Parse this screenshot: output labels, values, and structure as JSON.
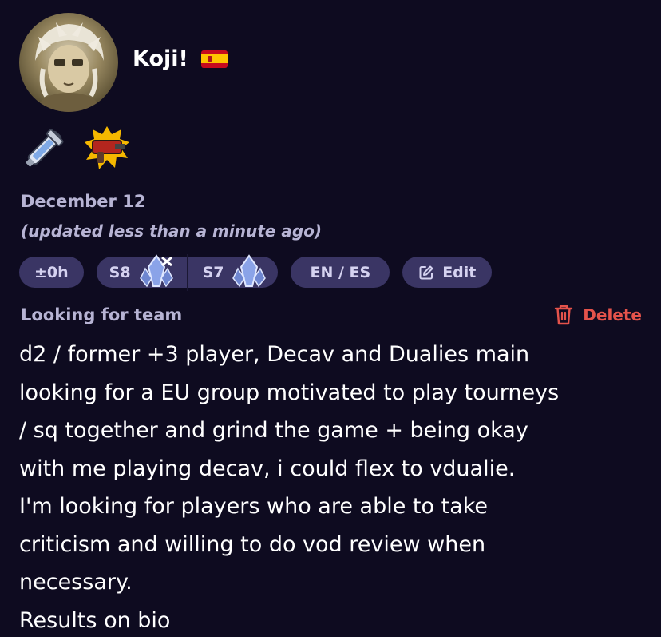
{
  "profile": {
    "username": "Koji!",
    "flag_icon": "spain-flag-icon",
    "avatar_icon": "avatar-portrait"
  },
  "badges": [
    {
      "icon": "weapon-badge-icon"
    },
    {
      "icon": "splat-weapon-badge-icon"
    }
  ],
  "post": {
    "date": "December 12",
    "updated": "(updated less than a minute ago)",
    "time_offset": "±0h",
    "ranks": [
      {
        "season": "S8",
        "icon": "rank-crystal-icon"
      },
      {
        "season": "S7",
        "icon": "rank-crystal-icon"
      }
    ],
    "languages": "EN / ES",
    "edit_label": "Edit",
    "type_label": "Looking for team",
    "delete_label": "Delete",
    "description_lines": [
      "d2 / former +3 player, Decav and Dualies main",
      "looking for a EU group motivated to play tourneys",
      "/ sq together and grind the game + being okay",
      "with me playing decav, i could flex to vdualie.",
      "I'm looking for players who are able to take",
      "criticism and willing to do vod review when",
      "necessary.",
      "Results on bio"
    ]
  },
  "colors": {
    "background": "#0e0b20",
    "pill": "#3a3564",
    "muted_text": "#b7b4d4",
    "danger": "#e5534b"
  }
}
